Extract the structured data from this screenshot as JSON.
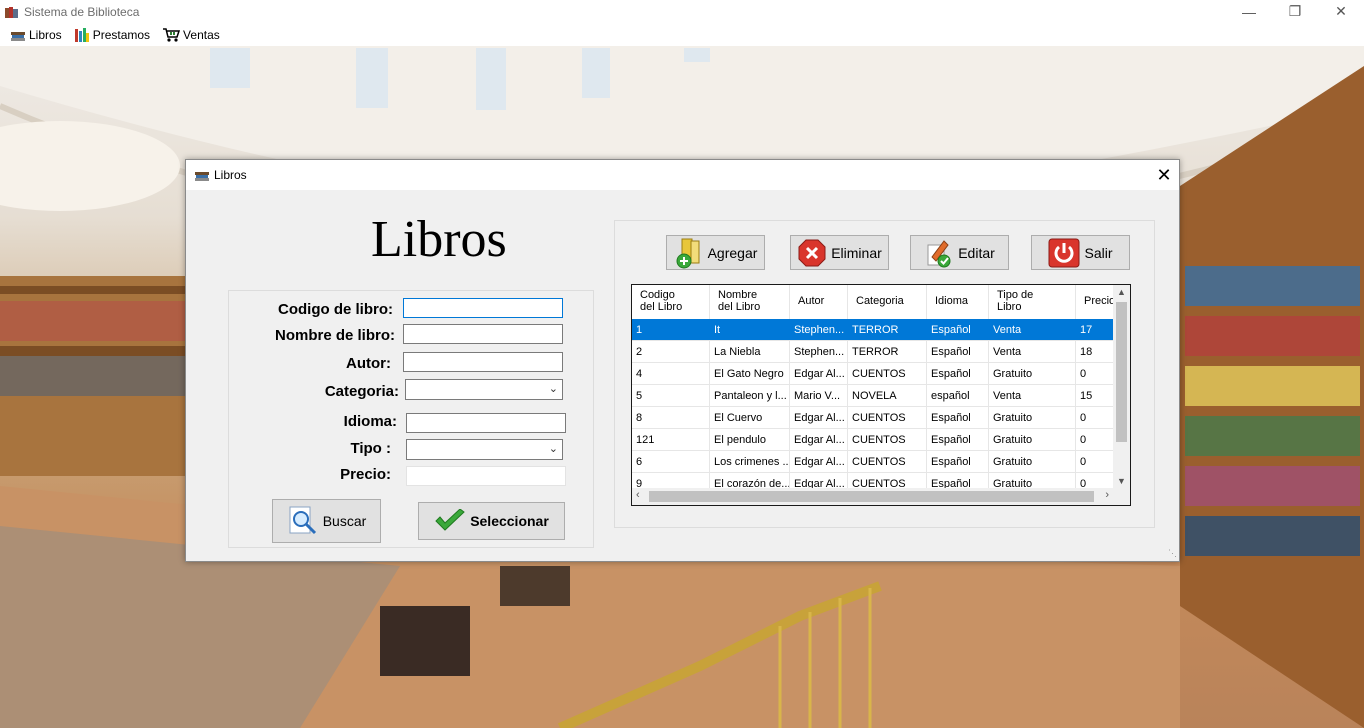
{
  "window": {
    "title": "Sistema de Biblioteca",
    "controls": {
      "minimize": "—",
      "restore": "❐",
      "close": "✕"
    }
  },
  "menu": {
    "items": [
      {
        "label": "Libros",
        "icon": "books-icon"
      },
      {
        "label": "Prestamos",
        "icon": "library-icon"
      },
      {
        "label": "Ventas",
        "icon": "cart-icon"
      }
    ]
  },
  "dialog": {
    "title": "Libros",
    "close": "✕",
    "heading": "Libros",
    "form": {
      "codigo_label": "Codigo de libro:",
      "nombre_label": "Nombre de libro:",
      "autor_label": "Autor:",
      "categoria_label": "Categoria:",
      "idioma_label": "Idioma:",
      "tipo_label": "Tipo :",
      "precio_label": "Precio:",
      "codigo_value": "",
      "nombre_value": "",
      "autor_value": "",
      "categoria_value": "",
      "idioma_value": "",
      "tipo_value": "",
      "precio_value": ""
    },
    "buttons": {
      "buscar": "Buscar",
      "seleccionar": "Seleccionar",
      "agregar": "Agregar",
      "eliminar": "Eliminar",
      "editar": "Editar",
      "salir": "Salir"
    },
    "grid": {
      "columns": [
        {
          "line1": "Codigo",
          "line2": "del Libro"
        },
        {
          "line1": "Nombre",
          "line2": "del Libro"
        },
        {
          "line1": "Autor",
          "line2": ""
        },
        {
          "line1": "Categoria",
          "line2": ""
        },
        {
          "line1": "Idioma",
          "line2": ""
        },
        {
          "line1": "Tipo de",
          "line2": "Libro"
        },
        {
          "line1": "Precio",
          "line2": ""
        }
      ],
      "rows": [
        [
          "1",
          "It",
          "Stephen...",
          "TERROR",
          "Español",
          "Venta",
          "17"
        ],
        [
          "2",
          "La Niebla",
          "Stephen...",
          "TERROR",
          "Español",
          "Venta",
          "18"
        ],
        [
          "4",
          "El Gato Negro",
          "Edgar Al...",
          "CUENTOS",
          "Español",
          "Gratuito",
          "0"
        ],
        [
          "5",
          "Pantaleon y l...",
          "Mario V...",
          "NOVELA",
          "español",
          "Venta",
          "15"
        ],
        [
          "8",
          "El Cuervo",
          "Edgar Al...",
          "CUENTOS",
          "Español",
          "Gratuito",
          "0"
        ],
        [
          "121",
          "El pendulo",
          "Edgar Al...",
          "CUENTOS",
          "Español",
          "Gratuito",
          "0"
        ],
        [
          "6",
          "Los crimenes ...",
          "Edgar Al...",
          "CUENTOS",
          "Español",
          "Gratuito",
          "0"
        ],
        [
          "9",
          "El corazón de...",
          "Edgar Al...",
          "CUENTOS",
          "Español",
          "Gratuito",
          "0"
        ]
      ],
      "selected_row": 0
    }
  },
  "colors": {
    "selection": "#0078d7",
    "dialog_bg": "#f0f0f0",
    "button_bg": "#e1e1e1"
  }
}
